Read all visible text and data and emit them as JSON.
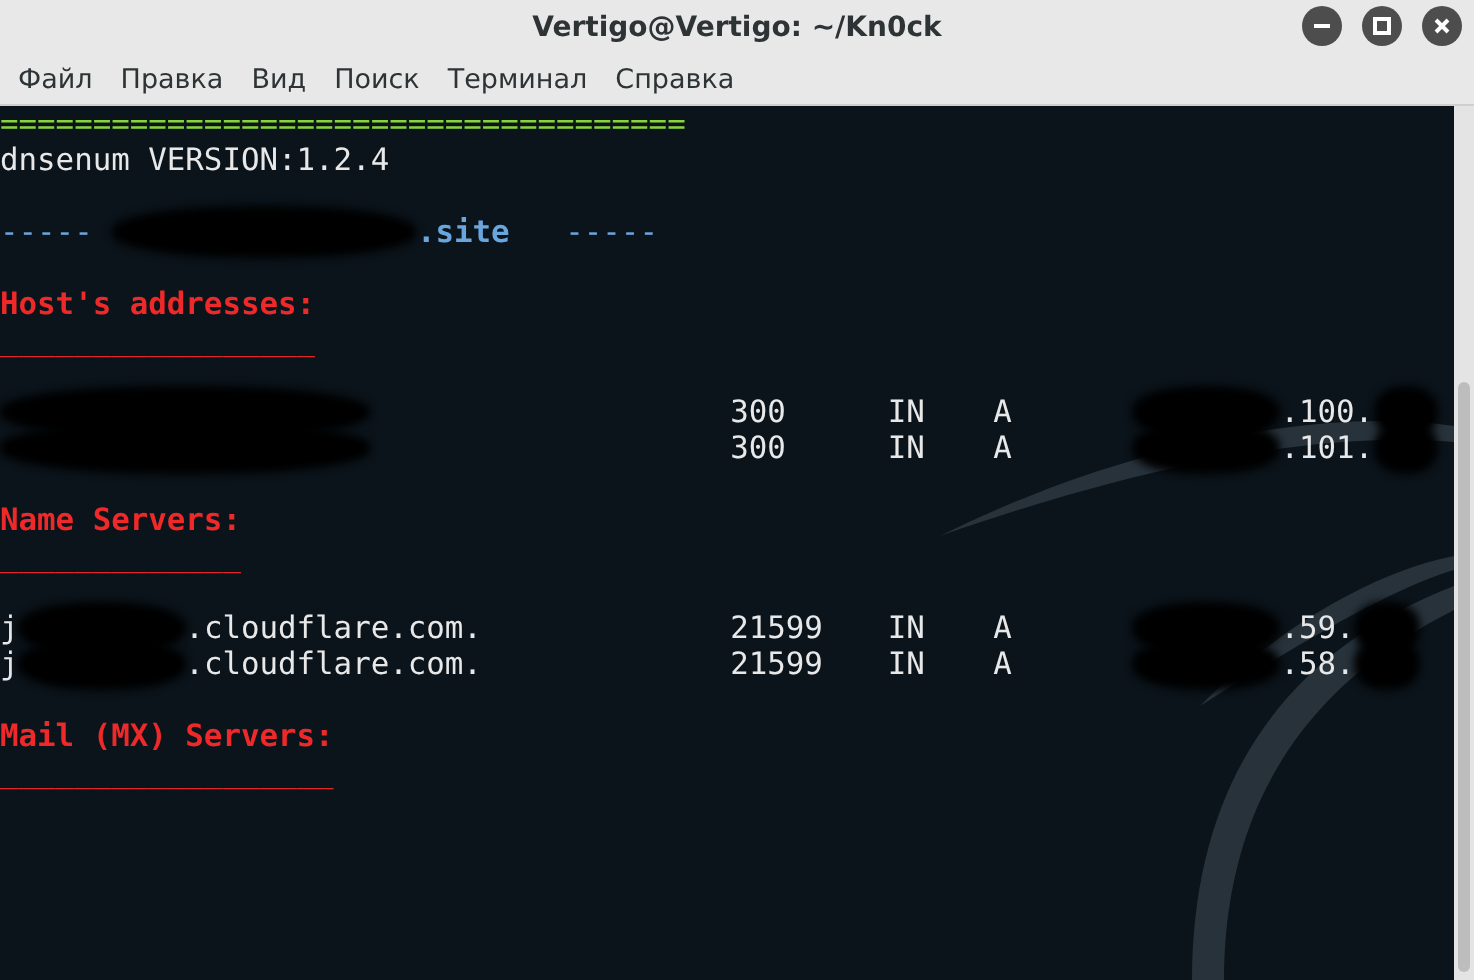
{
  "window": {
    "title": "Vertigo@Vertigo: ~/Kn0ck",
    "buttons": [
      {
        "kind": "minimize"
      },
      {
        "kind": "maximize"
      },
      {
        "kind": "close"
      }
    ]
  },
  "menu": [
    "Файл",
    "Правка",
    "Вид",
    "Поиск",
    "Терминал",
    "Справка"
  ],
  "terminal": {
    "lines": [
      {
        "kind": "rule",
        "text": "====================================="
      },
      {
        "kind": "text",
        "text": "dnsenum VERSION:1.2.4"
      },
      {
        "kind": "blank"
      },
      {
        "kind": "domain",
        "prefix": "-----",
        "redacted": true,
        "text": ".site",
        "suffix": "-----"
      },
      {
        "kind": "blank"
      },
      {
        "kind": "heading",
        "text": "Host's addresses:"
      },
      {
        "kind": "underline",
        "text": "_________________"
      },
      {
        "kind": "blank"
      },
      {
        "kind": "record",
        "name": {
          "redacted": true
        },
        "ttl": "300",
        "class": "IN",
        "type": "A",
        "address": {
          "redacted": true,
          "text": ".100.",
          "trailing_redacted": true
        }
      },
      {
        "kind": "record",
        "name": {
          "redacted": true
        },
        "ttl": "300",
        "class": "IN",
        "type": "A",
        "address": {
          "redacted": true,
          "text": ".101.",
          "trailing_redacted": true
        }
      },
      {
        "kind": "blank"
      },
      {
        "kind": "heading",
        "text": "Name Servers:"
      },
      {
        "kind": "underline",
        "text": "_____________"
      },
      {
        "kind": "blank"
      },
      {
        "kind": "record",
        "name": {
          "head": "j",
          "redacted": true,
          "text": ".cloudflare.com."
        },
        "ttl": "21599",
        "class": "IN",
        "type": "A",
        "address": {
          "redacted": true,
          "text": ".59.",
          "trailing_redacted": true
        }
      },
      {
        "kind": "record",
        "name": {
          "head": "j",
          "redacted": true,
          "text": ".cloudflare.com."
        },
        "ttl": "21599",
        "class": "IN",
        "type": "A",
        "address": {
          "redacted": true,
          "text": ".58.",
          "trailing_redacted": true
        }
      },
      {
        "kind": "blank"
      },
      {
        "kind": "heading",
        "text": "Mail (MX) Servers:"
      },
      {
        "kind": "underline",
        "text": "__________________"
      }
    ]
  }
}
